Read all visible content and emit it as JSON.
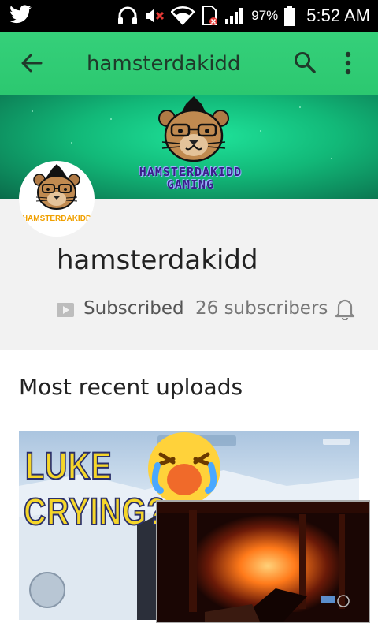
{
  "status_bar": {
    "battery_percent": "97%",
    "time": "5:52 AM",
    "icons": [
      "twitter-icon",
      "headphones-icon",
      "muted-volume-icon",
      "wifi-icon",
      "sim-error-icon",
      "signal-icon",
      "battery-icon"
    ]
  },
  "app_bar": {
    "title": "hamsterdakidd",
    "icons": [
      "back-arrow-icon",
      "search-icon",
      "more-vert-icon"
    ]
  },
  "banner": {
    "text_line1": "HAMSTERDAKIDD",
    "text_line2": "GAMING"
  },
  "channel": {
    "avatar_text": "HAMSTERDAKIDD",
    "name": "hamsterdakidd",
    "subscribed_label": "Subscribed",
    "subscriber_count": "26 subscribers"
  },
  "section": {
    "title": "Most recent uploads"
  },
  "video": {
    "thumbnail_line1": "LUKE",
    "thumbnail_line2": "CRYING?"
  },
  "colors": {
    "app_bar": "#2ecc71",
    "header_bg": "#f2f2f2",
    "thumb_text": "#f5d62a"
  }
}
